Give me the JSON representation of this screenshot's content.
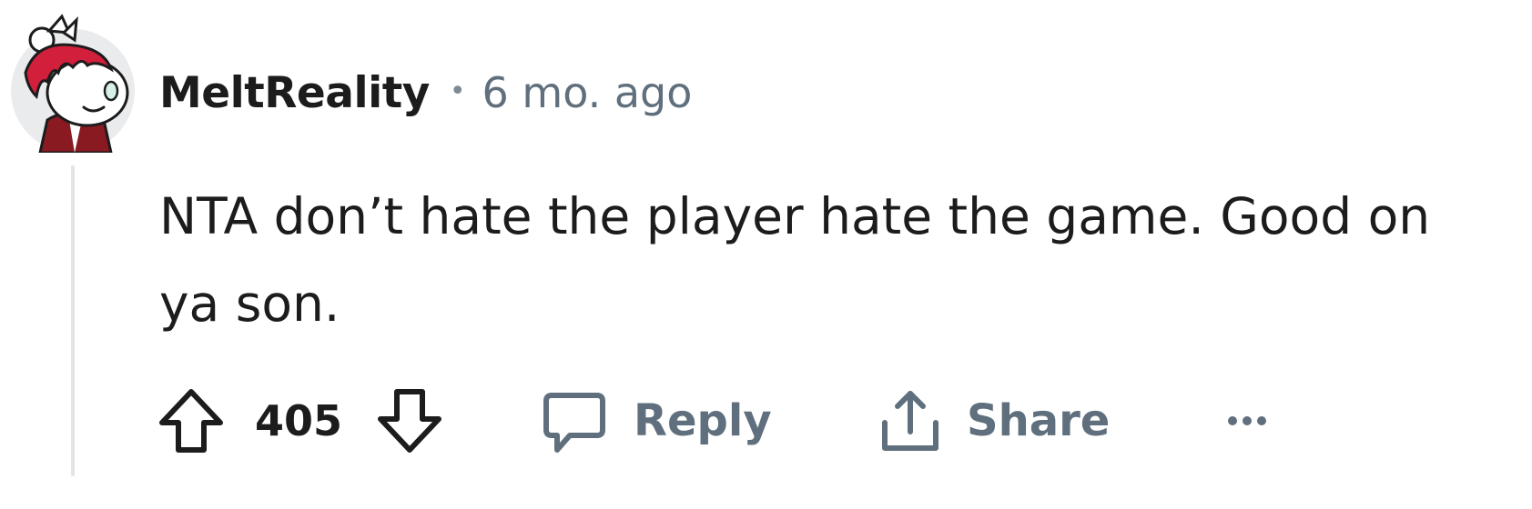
{
  "comment": {
    "author": "MeltReality",
    "separator": "•",
    "time_ago": "6 mo. ago",
    "text": "NTA don’t hate the player hate the game. Good on ya son.",
    "votes": "405",
    "actions": {
      "reply_label": "Reply",
      "share_label": "Share"
    }
  },
  "icons": {
    "avatar": "snoo-avatar-red-hair",
    "upvote": "arrow-up-icon",
    "downvote": "arrow-down-icon",
    "reply": "speech-bubble-icon",
    "share": "share-upload-icon",
    "more": "ellipsis-icon"
  },
  "colors": {
    "text_primary": "#1c1c1c",
    "text_secondary": "#5f6f7d",
    "thread_line": "#e2e4e6",
    "avatar_bg": "#e9ebed",
    "avatar_hair": "#d21f3c"
  }
}
